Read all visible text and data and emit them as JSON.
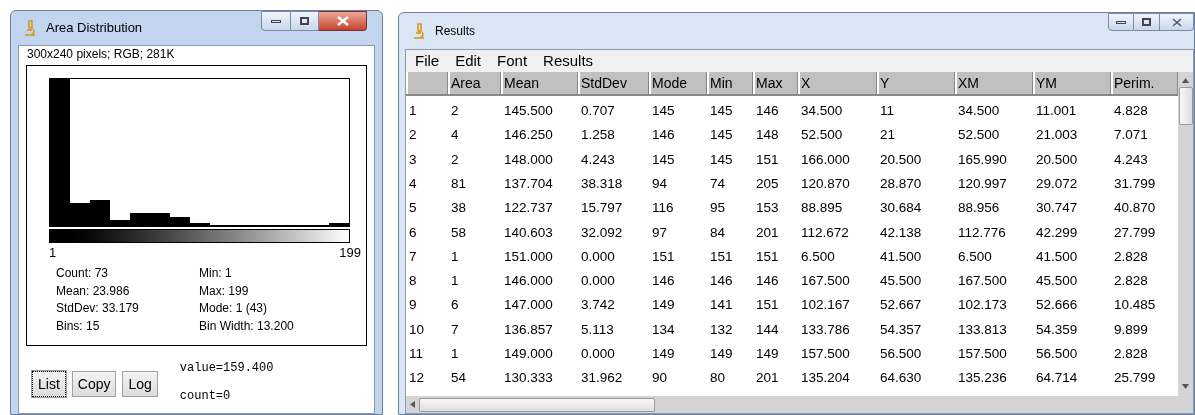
{
  "histogram_window": {
    "title": "Area Distribution",
    "info": "300x240 pixels; RGB; 281K",
    "axis_min": "1",
    "axis_max": "199",
    "stats_left": [
      "Count: 73",
      "Mean: 23.986",
      "StdDev: 33.179",
      "Bins: 15"
    ],
    "stats_right": [
      "Min: 1",
      "Max: 199",
      "Mode: 1 (43)",
      "Bin Width: 13.200"
    ],
    "buttons": [
      {
        "label": "List",
        "focused": true
      },
      {
        "label": "Copy",
        "focused": false
      },
      {
        "label": "Log",
        "focused": false
      }
    ],
    "value": "value=159.400",
    "count": "count=0"
  },
  "results_window": {
    "title": "Results",
    "menu": [
      "File",
      "Edit",
      "Font",
      "Results"
    ],
    "table": {
      "columns": [
        "",
        "Area",
        "Mean",
        "StdDev",
        "Mode",
        "Min",
        "Max",
        "X",
        "Y",
        "XM",
        "YM",
        "Perim."
      ],
      "rows": [
        [
          "1",
          "2",
          "145.500",
          "0.707",
          "145",
          "145",
          "146",
          "34.500",
          "11",
          "34.500",
          "11.001",
          "4.828"
        ],
        [
          "2",
          "4",
          "146.250",
          "1.258",
          "146",
          "145",
          "148",
          "52.500",
          "21",
          "52.500",
          "21.003",
          "7.071"
        ],
        [
          "3",
          "2",
          "148.000",
          "4.243",
          "145",
          "145",
          "151",
          "166.000",
          "20.500",
          "165.990",
          "20.500",
          "4.243"
        ],
        [
          "4",
          "81",
          "137.704",
          "38.318",
          "94",
          "74",
          "205",
          "120.870",
          "28.870",
          "120.997",
          "29.072",
          "31.799"
        ],
        [
          "5",
          "38",
          "122.737",
          "15.797",
          "116",
          "95",
          "153",
          "88.895",
          "30.684",
          "88.956",
          "30.747",
          "40.870"
        ],
        [
          "6",
          "58",
          "140.603",
          "32.092",
          "97",
          "84",
          "201",
          "112.672",
          "42.138",
          "112.776",
          "42.299",
          "27.799"
        ],
        [
          "7",
          "1",
          "151.000",
          "0.000",
          "151",
          "151",
          "151",
          "6.500",
          "41.500",
          "6.500",
          "41.500",
          "2.828"
        ],
        [
          "8",
          "1",
          "146.000",
          "0.000",
          "146",
          "146",
          "146",
          "167.500",
          "45.500",
          "167.500",
          "45.500",
          "2.828"
        ],
        [
          "9",
          "6",
          "147.000",
          "3.742",
          "149",
          "141",
          "151",
          "102.167",
          "52.667",
          "102.173",
          "52.666",
          "10.485"
        ],
        [
          "10",
          "7",
          "136.857",
          "5.113",
          "134",
          "132",
          "144",
          "133.786",
          "54.357",
          "133.813",
          "54.359",
          "9.899"
        ],
        [
          "11",
          "1",
          "149.000",
          "0.000",
          "149",
          "149",
          "149",
          "157.500",
          "56.500",
          "157.500",
          "56.500",
          "2.828"
        ],
        [
          "12",
          "54",
          "130.333",
          "31.962",
          "90",
          "80",
          "201",
          "135.204",
          "64.630",
          "135.236",
          "64.714",
          "25.799"
        ]
      ]
    }
  }
}
